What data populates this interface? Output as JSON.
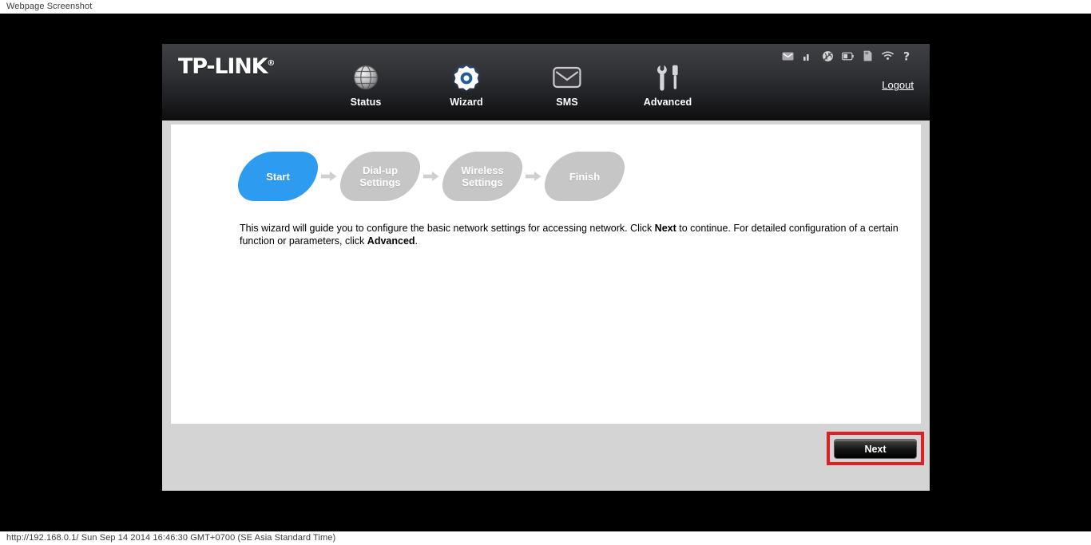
{
  "capture": {
    "title": "Webpage Screenshot",
    "url_status": "http://192.168.0.1/ Sun Sep 14 2014 16:46:30 GMT+0700 (SE Asia Standard Time)"
  },
  "header": {
    "logo": "TP-LINK",
    "logo_trademark": "®",
    "logout_label": "Logout",
    "status_icons": [
      {
        "name": "mail-icon",
        "glyph": "✉"
      },
      {
        "name": "signal-bars-icon",
        "glyph": "▃"
      },
      {
        "name": "globe-disconnected-icon",
        "glyph": "ἱ0"
      },
      {
        "name": "battery-icon",
        "glyph": "▭"
      },
      {
        "name": "sim-card-icon",
        "glyph": "▯"
      },
      {
        "name": "wifi-icon",
        "glyph": "◠"
      },
      {
        "name": "help-icon",
        "glyph": "?"
      }
    ],
    "nav": [
      {
        "id": "status",
        "label": "Status",
        "icon": "globe-icon",
        "active": false
      },
      {
        "id": "wizard",
        "label": "Wizard",
        "icon": "wizard-gear-icon",
        "active": true
      },
      {
        "id": "sms",
        "label": "SMS",
        "icon": "envelope-icon",
        "active": false
      },
      {
        "id": "advanced",
        "label": "Advanced",
        "icon": "tools-icon",
        "active": false
      }
    ]
  },
  "wizard": {
    "steps": [
      {
        "label": "Start",
        "current": true
      },
      {
        "label": "Dial-up\nSettings",
        "label_line1": "Dial-up",
        "label_line2": "Settings",
        "current": false
      },
      {
        "label": "Wireless\nSettings",
        "label_line1": "Wireless",
        "label_line2": "Settings",
        "current": false
      },
      {
        "label": "Finish",
        "current": false
      }
    ],
    "description_part1": "This wizard will guide you to configure the basic network settings for accessing network. Click ",
    "description_bold1": "Next",
    "description_part2": " to continue. For detailed configuration of a certain function or parameters, click ",
    "description_bold2": "Advanced",
    "description_part3": ".",
    "next_label": "Next"
  },
  "colors": {
    "accent_blue": "#2d9cf0",
    "step_gray": "#c6c6c6",
    "highlight_red": "#e21d24",
    "panel_gray": "#d4d4d4"
  }
}
